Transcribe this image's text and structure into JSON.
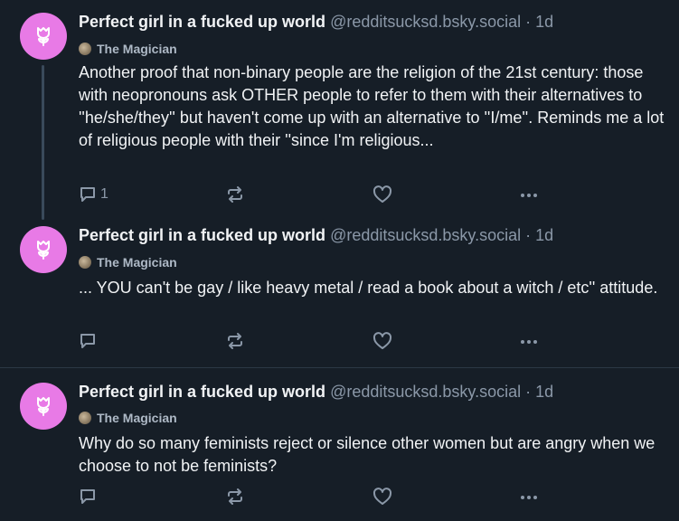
{
  "posts": [
    {
      "author": "Perfect girl in a fucked up world",
      "handle": "@redditsucksd.bsky.social",
      "separator": "·",
      "time": "1d",
      "badge": "The Magician",
      "text": "Another proof that non-binary people are the religion of the 21st century: those with neopronouns ask OTHER people to refer to them with their alternatives to ''he/she/they'' but haven't come up with an alternative to ''I/me''. Reminds me a lot of religious people with their ''since I'm religious...",
      "reply_count": "1"
    },
    {
      "author": "Perfect girl in a fucked up world",
      "handle": "@redditsucksd.bsky.social",
      "separator": "·",
      "time": "1d",
      "badge": "The Magician",
      "text": "... YOU can't be gay / like heavy metal / read a book about a witch / etc'' attitude.",
      "reply_count": ""
    },
    {
      "author": "Perfect girl in a fucked up world",
      "handle": "@redditsucksd.bsky.social",
      "separator": "·",
      "time": "1d",
      "badge": "The Magician",
      "text": "Why do so many feminists reject or silence other women but are angry when we choose to not be feminists?",
      "reply_count": ""
    }
  ],
  "icons": {
    "avatar": "flower-icon",
    "badge": "magician-badge-icon",
    "reply": "reply-icon",
    "repost": "repost-icon",
    "like": "heart-icon",
    "more": "more-icon"
  },
  "colors": {
    "background": "#161e27",
    "avatar": "#e87ae6",
    "muted": "#8b98a8",
    "thread_line": "#3a4a5b"
  }
}
